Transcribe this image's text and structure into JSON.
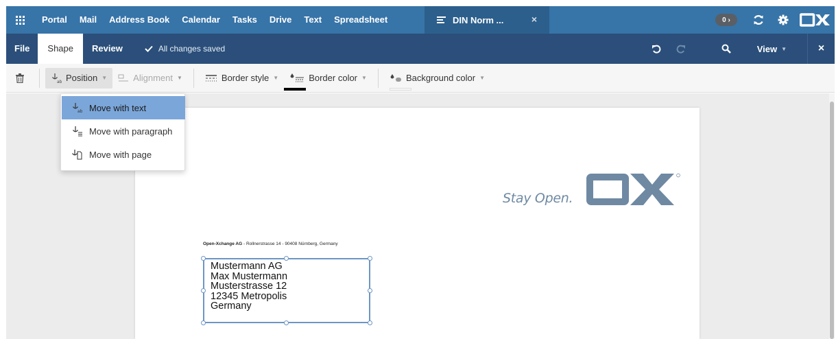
{
  "topbar": {
    "apps_icon": "apps-grid-icon",
    "nav": [
      "Portal",
      "Mail",
      "Address Book",
      "Calendar",
      "Tasks",
      "Drive",
      "Text",
      "Spreadsheet"
    ],
    "doc_tab": {
      "title": "DIN Norm ...",
      "close_label": "×"
    },
    "badge": "0 ›",
    "colors": {
      "bar": "#3774a8",
      "active_tab": "#2c5f8c"
    }
  },
  "tabbar": {
    "tabs": [
      "File",
      "Shape",
      "Review"
    ],
    "active_tab": "Shape",
    "saved_status": "All changes saved",
    "view_label": "View",
    "close_label": "×"
  },
  "toolbar": {
    "position_label": "Position",
    "alignment_label": "Alignment",
    "border_style_label": "Border style",
    "border_color_label": "Border color",
    "background_color_label": "Background color",
    "border_color_value": "#000000"
  },
  "dropdown": {
    "items": [
      "Move with text",
      "Move with paragraph",
      "Move with page"
    ],
    "selected": "Move with text"
  },
  "document": {
    "slogan": "Stay Open.",
    "sender_company": "Open-Xchange AG",
    "sender_address": " - Rollnerstrasse 14 - 90408 Nürnberg, Germany",
    "address_lines": [
      "Mustermann AG",
      "Max Mustermann",
      "Musterstrasse 12",
      "12345 Metropolis",
      "Germany"
    ]
  }
}
